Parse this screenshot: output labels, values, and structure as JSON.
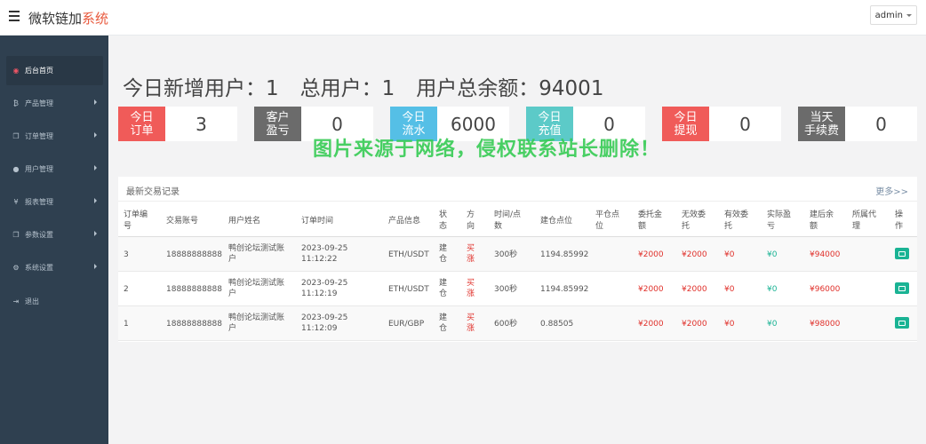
{
  "header": {
    "brand_main": "微软链加",
    "brand_accent": "系统",
    "user": "admin"
  },
  "sidebar": {
    "items": [
      {
        "label": "后台首页",
        "icon": "dashboard-icon",
        "active": true
      },
      {
        "label": "产品管理",
        "icon": "bitcoin-icon"
      },
      {
        "label": "订单管理",
        "icon": "copy-icon"
      },
      {
        "label": "用户管理",
        "icon": "user-icon"
      },
      {
        "label": "报表管理",
        "icon": "yen-icon"
      },
      {
        "label": "参数设置",
        "icon": "copy-icon"
      },
      {
        "label": "系统设置",
        "icon": "gears-icon"
      },
      {
        "label": "退出",
        "icon": "logout-icon"
      }
    ]
  },
  "summary": {
    "new_users": "今日新增用户：1",
    "total_users": "总用户：1",
    "total_balance": "用户总余额：94001"
  },
  "stats": [
    {
      "label": "今日\n订单",
      "value": "3",
      "color": "#ed5565"
    },
    {
      "label": "客户\n盈亏",
      "value": "0",
      "color": "#676a6c"
    },
    {
      "label": "今日\n流水",
      "value": "6000",
      "color": "#4fc3e8"
    },
    {
      "label": "今日\n充值",
      "value": "0",
      "color": "#5bc8c8"
    },
    {
      "label": "今日\n提现",
      "value": "0",
      "color": "#ed5565"
    },
    {
      "label": "当天\n手续费",
      "value": "0",
      "color": "#676a6c"
    }
  ],
  "watermark": "图片来源于网络，侵权联系站长删除！",
  "panel": {
    "title": "最新交易记录",
    "more": "更多>>"
  },
  "table": {
    "headers": [
      "订单编\n号",
      "交易账号",
      "用户姓名",
      "订单时间",
      "产品信息",
      "状\n态",
      "方\n向",
      "时间/点\n数",
      "建仓点位",
      "平仓点\n位",
      "委托金\n额",
      "无效委\n托",
      "有效委\n托",
      "实际盈\n亏",
      "建后余\n额",
      "所属代\n理",
      "操\n作"
    ],
    "rows": [
      {
        "id": "3",
        "account": "18888888888",
        "name": "鸭创论坛测试账\n户",
        "time": "2023-09-25\n11:12:22",
        "product": "ETH/USDT",
        "status": "建\n仓",
        "direction": "买\n涨",
        "duration": "300秒",
        "open_price": "1194.85992",
        "close_price": "",
        "amount": "¥2000",
        "invalid": "¥2000",
        "valid": "¥0",
        "profit": "¥0",
        "balance": "¥94000",
        "agent": ""
      },
      {
        "id": "2",
        "account": "18888888888",
        "name": "鸭创论坛测试账\n户",
        "time": "2023-09-25\n11:12:19",
        "product": "ETH/USDT",
        "status": "建\n仓",
        "direction": "买\n涨",
        "duration": "300秒",
        "open_price": "1194.85992",
        "close_price": "",
        "amount": "¥2000",
        "invalid": "¥2000",
        "valid": "¥0",
        "profit": "¥0",
        "balance": "¥96000",
        "agent": ""
      },
      {
        "id": "1",
        "account": "18888888888",
        "name": "鸭创论坛测试账\n户",
        "time": "2023-09-25\n11:12:09",
        "product": "EUR/GBP",
        "status": "建\n仓",
        "direction": "买\n涨",
        "duration": "600秒",
        "open_price": "0.88505",
        "close_price": "",
        "amount": "¥2000",
        "invalid": "¥2000",
        "valid": "¥0",
        "profit": "¥0",
        "balance": "¥98000",
        "agent": ""
      }
    ]
  }
}
